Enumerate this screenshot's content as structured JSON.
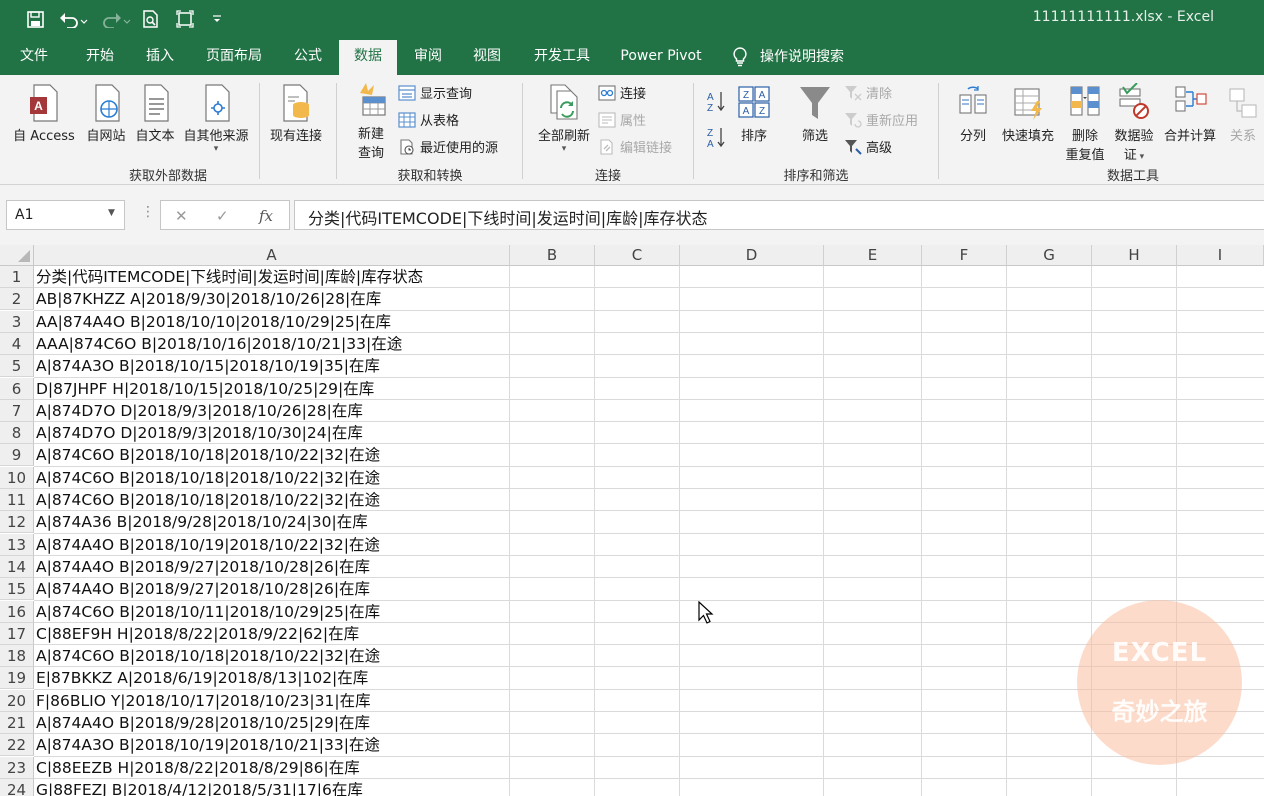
{
  "title_bar": {
    "title": "11111111111.xlsx  -  Excel"
  },
  "tabs": [
    "文件",
    "开始",
    "插入",
    "页面布局",
    "公式",
    "数据",
    "审阅",
    "视图",
    "开发工具",
    "Power Pivot",
    "操作说明搜索"
  ],
  "active_tab": "数据",
  "ribbon": {
    "get_external": {
      "label": "获取外部数据",
      "from_access": "自 Access",
      "from_web": "自网站",
      "from_text": "自文本",
      "from_other": "自其他来源",
      "existing": "现有连接"
    },
    "get_transform": {
      "label": "获取和转换",
      "new_query_1": "新建",
      "new_query_2": "查询",
      "show_queries": "显示查询",
      "from_table": "从表格",
      "recent_sources": "最近使用的源"
    },
    "connections": {
      "label": "连接",
      "refresh_all": "全部刷新",
      "connections": "连接",
      "properties": "属性",
      "edit_links": "编辑链接"
    },
    "sort_filter": {
      "label": "排序和筛选",
      "sort": "排序",
      "filter": "筛选",
      "clear": "清除",
      "reapply": "重新应用",
      "advanced": "高级"
    },
    "data_tools": {
      "label": "数据工具",
      "text_to_columns": "分列",
      "flash_fill": "快速填充",
      "remove_dup_1": "删除",
      "remove_dup_2": "重复值",
      "validation_1": "数据验",
      "validation_2": "证",
      "consolidate": "合并计算",
      "relationships": "关系"
    }
  },
  "formula_bar": {
    "name_box": "A1",
    "cancel": "✕",
    "enter": "✓",
    "fx": "fx",
    "content": "分类|代码ITEMCODE|下线时间|发运时间|库龄|库存状态"
  },
  "columns": [
    "A",
    "B",
    "C",
    "D",
    "E",
    "F",
    "G",
    "H",
    "I"
  ],
  "rows": [
    "分类|代码ITEMCODE|下线时间|发运时间|库龄|库存状态",
    "AB|87KHZZ A|2018/9/30|2018/10/26|28|在库",
    "AA|874A4O B|2018/10/10|2018/10/29|25|在库",
    "AAA|874C6O B|2018/10/16|2018/10/21|33|在途",
    "A|874A3O B|2018/10/15|2018/10/19|35|在库",
    "D|87JHPF H|2018/10/15|2018/10/25|29|在库",
    "A|874D7O D|2018/9/3|2018/10/26|28|在库",
    "A|874D7O D|2018/9/3|2018/10/30|24|在库",
    "A|874C6O B|2018/10/18|2018/10/22|32|在途",
    "A|874C6O B|2018/10/18|2018/10/22|32|在途",
    "A|874C6O B|2018/10/18|2018/10/22|32|在途",
    "A|874A36 B|2018/9/28|2018/10/24|30|在库",
    "A|874A4O B|2018/10/19|2018/10/22|32|在途",
    "A|874A4O B|2018/9/27|2018/10/28|26|在库",
    "A|874A4O B|2018/9/27|2018/10/28|26|在库",
    "A|874C6O B|2018/10/11|2018/10/29|25|在库",
    "C|88EF9H H|2018/8/22|2018/9/22|62|在库",
    "A|874C6O B|2018/10/18|2018/10/22|32|在途",
    "E|87BKKZ A|2018/6/19|2018/8/13|102|在库",
    "F|86BLIO Y|2018/10/17|2018/10/23|31|在库",
    "A|874A4O B|2018/9/28|2018/10/25|29|在库",
    "A|874A3O B|2018/10/19|2018/10/21|33|在途",
    "C|88EEZB H|2018/8/22|2018/8/29|86|在库",
    "G|88FEZJ B|2018/4/12|2018/5/31|17|6在库"
  ],
  "watermark": {
    "line1": "EXCEL",
    "line2": "奇妙之旅"
  },
  "colors": {
    "excel_green": "#217346",
    "ribbon_bg": "#f3f3f3",
    "watermark": "#fabea0"
  }
}
